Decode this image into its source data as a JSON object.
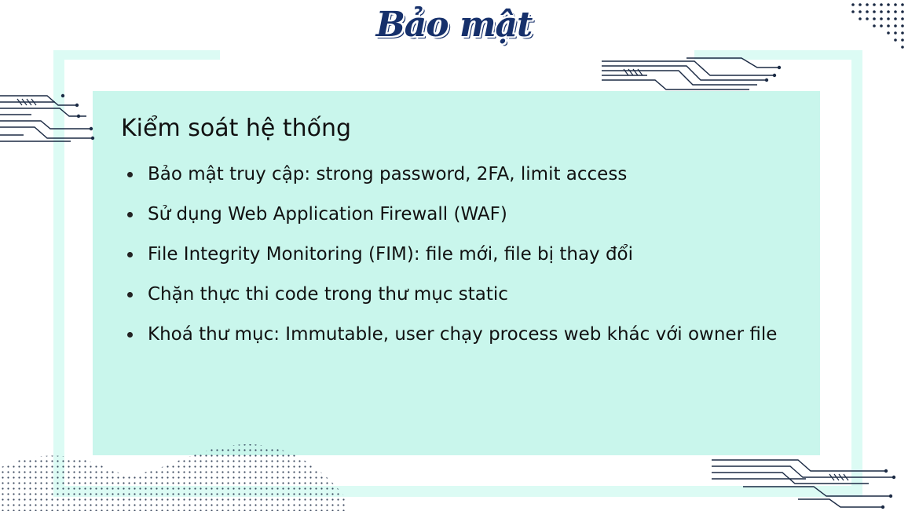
{
  "slide": {
    "brand_title": "Bảo mật",
    "heading": "Kiểm soát hệ thống",
    "bullets": [
      "Bảo mật truy cập: strong password, 2FA, limit access",
      "Sử dụng Web Application Firewall (WAF)",
      "File Integrity Monitoring (FIM): file mới, file bị thay đổi",
      "Chặn thực thi code trong thư mục static",
      "Khoá thư mục: Immutable, user chạy process web khác với owner file"
    ]
  },
  "colors": {
    "title": "#16306b",
    "panel": "#c9f6ec",
    "frame": "#dcfbf4",
    "decor": "#1b2a44"
  },
  "decorations": [
    "circuit-lines-left",
    "circuit-lines-top-right",
    "circuit-lines-bottom-right",
    "dot-pattern-top-right",
    "dot-wave-bottom-left"
  ]
}
